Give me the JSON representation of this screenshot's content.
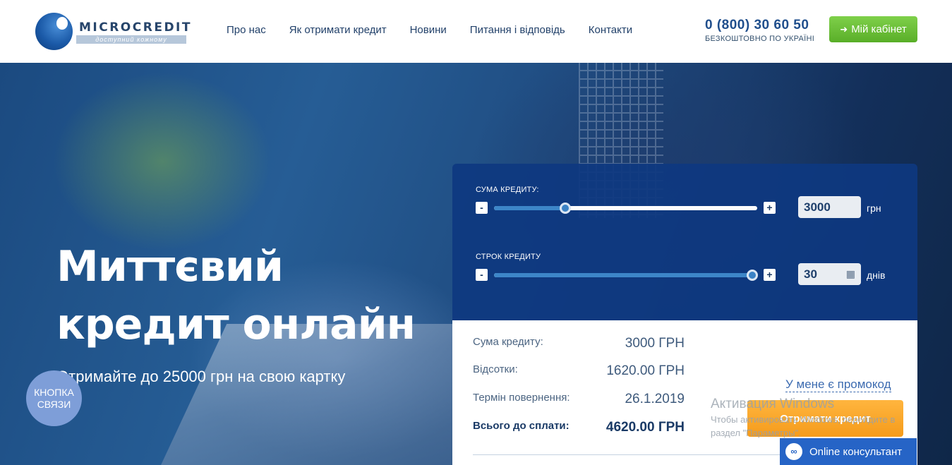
{
  "header": {
    "logo": {
      "name": "MICROCREDIT",
      "tagline": "доступний кожному"
    },
    "nav": [
      {
        "label": "Про нас"
      },
      {
        "label": "Як отримати кредит"
      },
      {
        "label": "Новини"
      },
      {
        "label": "Питання і відповідь"
      },
      {
        "label": "Контакти"
      }
    ],
    "phone": "0 (800) 30 60 50",
    "phone_note": "БЕЗКОШТОВНО ПО УКРАЇНІ",
    "cabinet_button": "Мій кабінет",
    "cabinet_icon": "login-icon"
  },
  "hero": {
    "title_line1": "Миттєвий",
    "title_line2": "кредит онлайн",
    "subtitle": "Отримайте до 25000 грн на свою картку",
    "contact_button_line1": "КНОПКА",
    "contact_button_line2": "СВЯЗИ"
  },
  "calculator": {
    "amount_label": "СУМА КРЕДИТУ:",
    "amount_value": "3000",
    "amount_unit": "грн",
    "amount_slider_fraction": 0.27,
    "term_label": "СТРОК КРЕДИТУ",
    "term_value": "30",
    "term_unit": "днів",
    "term_slider_fraction": 0.98,
    "minus": "-",
    "plus": "+",
    "calendar_icon": "calendar-icon"
  },
  "summary": {
    "rows": [
      {
        "label": "Сума кредиту:",
        "value": "3000 ГРН"
      },
      {
        "label": "Відсотки:",
        "value": "1620.00 ГРН"
      },
      {
        "label": "Термін повернення:",
        "value": "26.1.2019"
      },
      {
        "label": "Всього до сплати:",
        "value": "4620.00 ГРН"
      }
    ],
    "promo_link": "У мене є промокод",
    "get_credit_button": "Отримати кредит"
  },
  "watermark": {
    "title": "Активация Windows",
    "line1": "Чтобы активировать Windows, перейдите в",
    "line2": "раздел \"Параметры\"."
  },
  "online_consultant": {
    "label": "Online консультант",
    "icon": "chat-icon"
  },
  "colors": {
    "brand_blue": "#1f4e8c",
    "green_button": "#59ae28",
    "orange_button": "#f59b1b",
    "calc_panel": "#0e3880"
  }
}
